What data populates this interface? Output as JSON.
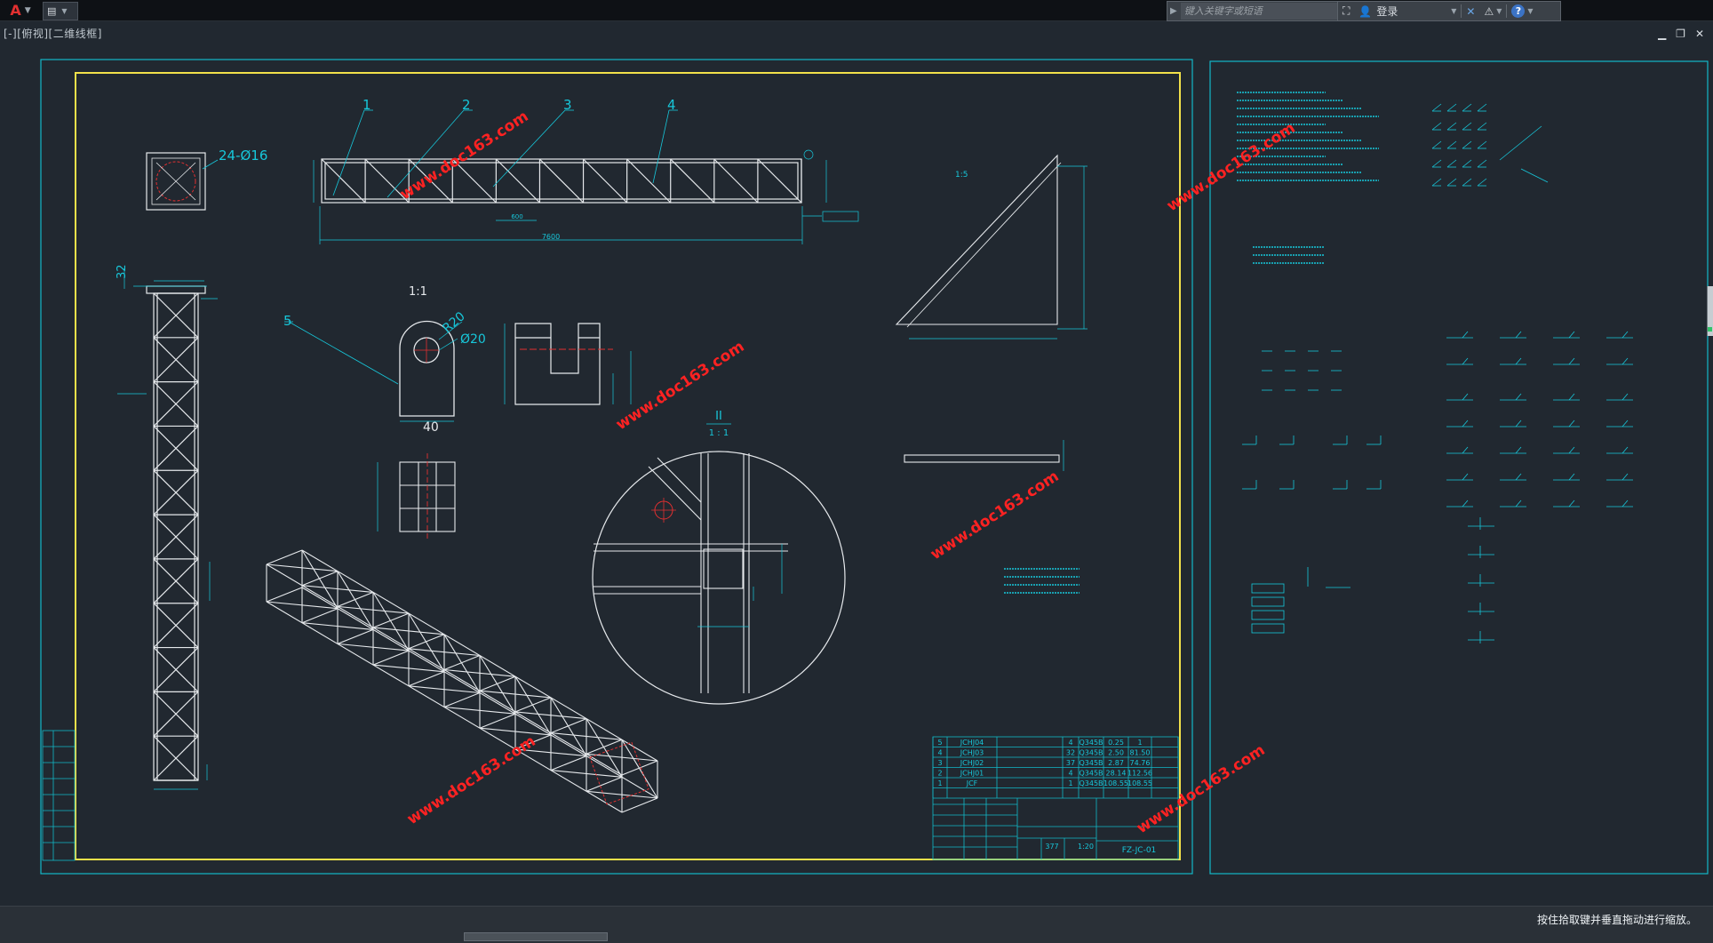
{
  "titlebar": {
    "app_logo": "A",
    "search_placeholder": "键入关键字或短语",
    "login_label": "登录",
    "help_label": "?"
  },
  "viewport": {
    "label": "[-][俯视][二维线框]"
  },
  "drawing": {
    "dimensions": {
      "hole_pattern": "24-Ø16",
      "pin_radius": "R20",
      "pin_hole": "Ø20",
      "pin_width": "40",
      "tower_top": "32"
    },
    "balloons": [
      "1",
      "2",
      "3",
      "4",
      "5"
    ],
    "scales": {
      "pin": "1:1",
      "detail": "II",
      "detail_scale": "1 : 1",
      "bracket": "1:5"
    },
    "title_block": {
      "rows": [
        {
          "no": "5",
          "code": "JCHJ04",
          "qty": "4",
          "material": "Q345B",
          "unit": "0.25",
          "total": "1"
        },
        {
          "no": "4",
          "code": "JCHJ03",
          "qty": "32",
          "material": "Q345B",
          "unit": "2.50",
          "total": "81.50"
        },
        {
          "no": "3",
          "code": "JCHJ02",
          "qty": "37",
          "material": "Q345B",
          "unit": "2.87",
          "total": "74.76"
        },
        {
          "no": "2",
          "code": "JCHJ01",
          "qty": "4",
          "material": "Q345B",
          "unit": "28.14",
          "total": "112.56"
        },
        {
          "no": "1",
          "code": "JCF",
          "qty": "1",
          "material": "Q345B",
          "unit": "108.55",
          "total": "108.55"
        }
      ],
      "weight": "377",
      "scale": "1:20",
      "drawing_no": "FZ-JC-01"
    },
    "watermark": "www.doc163.com"
  },
  "colors": {
    "background": "#212830",
    "frame_outer": "#12b8c8",
    "frame_inner": "#f2e14a",
    "lines": "#e6e9ec",
    "dims": "#17c7da",
    "center": "#e23030",
    "watermark": "#ff2222"
  },
  "statusbar": {
    "message": "按住拾取键并垂直拖动进行缩放。"
  }
}
